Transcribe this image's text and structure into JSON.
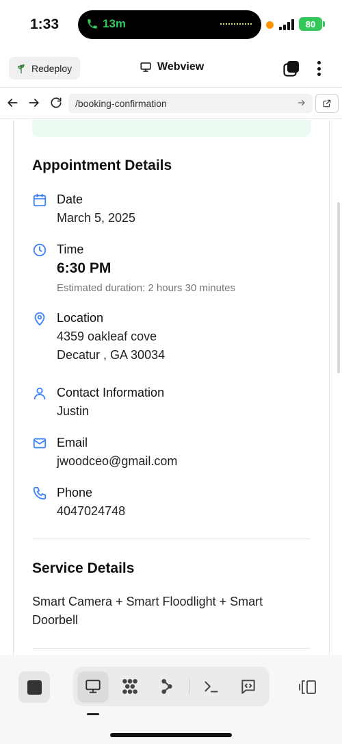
{
  "status": {
    "time": "1:33",
    "call_duration": "13m",
    "battery": "80"
  },
  "app_bar": {
    "redeploy_label": "Redeploy",
    "title": "Webview"
  },
  "url_bar": {
    "url": "/booking-confirmation"
  },
  "appointment": {
    "title": "Appointment Details",
    "date_label": "Date",
    "date_value": "March 5, 2025",
    "time_label": "Time",
    "time_value": "6:30 PM",
    "duration": "Estimated duration: 2 hours 30 minutes",
    "location_label": "Location",
    "location_line1": "4359 oakleaf cove",
    "location_line2": "Decatur , GA 30034",
    "contact_label": "Contact Information",
    "contact_value": "Justin",
    "email_label": "Email",
    "email_value": "jwoodceo@gmail.com",
    "phone_label": "Phone",
    "phone_value": "4047024748"
  },
  "service": {
    "title": "Service Details",
    "description": "Smart Camera + Smart Floodlight + Smart Doorbell"
  },
  "colors": {
    "accent": "#3b82f6",
    "success_bg": "#eafaf0",
    "call_green": "#34c759",
    "battery_green": "#34c759"
  },
  "icons": [
    "phone-icon",
    "plant-icon",
    "monitor-icon",
    "stack-icon",
    "calendar-icon",
    "clock-icon",
    "map-pin-icon",
    "user-icon",
    "mail-icon",
    "phone-outline-icon",
    "grid-icon",
    "flow-icon",
    "terminal-icon",
    "code-icon",
    "split-view-icon"
  ]
}
